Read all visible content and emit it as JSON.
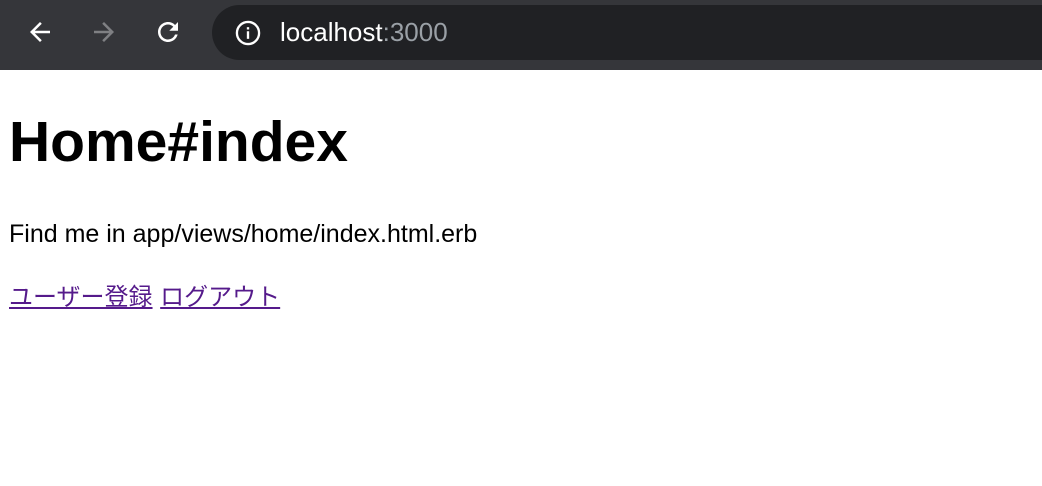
{
  "browser": {
    "url_host": "localhost",
    "url_port": ":3000",
    "icons": {
      "back": "back-arrow-icon",
      "forward": "forward-arrow-icon",
      "reload": "reload-icon",
      "site_info": "info-icon"
    },
    "colors": {
      "toolbar": "#35363a",
      "omnibox": "#202124",
      "port_text": "#9aa0a6"
    }
  },
  "page": {
    "heading": "Home#index",
    "paragraph": "Find me in app/views/home/index.html.erb",
    "links": [
      {
        "label": "ユーザー登録"
      },
      {
        "label": "ログアウト"
      }
    ],
    "colors": {
      "link": "#551a8b",
      "background": "#ffffff"
    }
  }
}
